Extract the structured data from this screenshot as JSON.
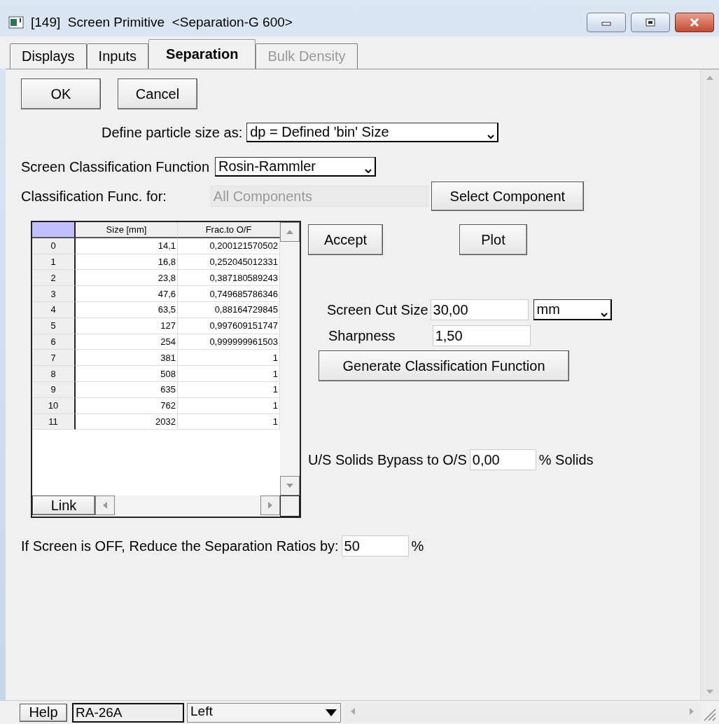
{
  "window": {
    "title": "[149]  Screen Primitive  <Separation-G 600>"
  },
  "tabs": [
    {
      "label": "Displays",
      "selected": false,
      "disabled": false
    },
    {
      "label": "Inputs",
      "selected": false,
      "disabled": false
    },
    {
      "label": "Separation",
      "selected": true,
      "disabled": false
    },
    {
      "label": "Bulk Density",
      "selected": false,
      "disabled": true
    }
  ],
  "buttons": [
    "OK",
    "Cancel"
  ],
  "particle_size": {
    "label": "Define particle size as:",
    "value": "dp = Defined 'bin' Size"
  },
  "classification_function": {
    "label": "Screen Classification Function",
    "value": "Rosin-Rammler"
  },
  "classification_for": {
    "label": "Classification Func. for:",
    "value": "All Components",
    "disabled": true,
    "button": "Select Component"
  },
  "table": {
    "columns": [
      "Size [mm]",
      "Frac.to O/F"
    ],
    "rows": [
      {
        "index": "0",
        "cells": [
          "14,1",
          "0,200121570502"
        ]
      },
      {
        "index": "1",
        "cells": [
          "16,8",
          "0,252045012331"
        ]
      },
      {
        "index": "2",
        "cells": [
          "23,8",
          "0,387180589243"
        ]
      },
      {
        "index": "3",
        "cells": [
          "47,6",
          "0,749685786346"
        ]
      },
      {
        "index": "4",
        "cells": [
          "63,5",
          "0,88164729845"
        ]
      },
      {
        "index": "5",
        "cells": [
          "127",
          "0,997609151747"
        ]
      },
      {
        "index": "6",
        "cells": [
          "254",
          "0,999999961503"
        ]
      },
      {
        "index": "7",
        "cells": [
          "381",
          "1"
        ]
      },
      {
        "index": "8",
        "cells": [
          "508",
          "1"
        ]
      },
      {
        "index": "9",
        "cells": [
          "635",
          "1"
        ]
      },
      {
        "index": "10",
        "cells": [
          "762",
          "1"
        ]
      },
      {
        "index": "11",
        "cells": [
          "2032",
          "1"
        ]
      }
    ],
    "link_button": "Link"
  },
  "accept_button": "Accept",
  "plot_button": "Plot",
  "cut_size": {
    "label": "Screen Cut Size",
    "value": "30,00",
    "unit": "mm"
  },
  "sharpness": {
    "label": "Sharpness",
    "value": "1,50"
  },
  "generate_button": "Generate Classification Function",
  "bypass": {
    "label": "U/S Solids Bypass to O/S",
    "value": "0,00",
    "unit": "% Solids"
  },
  "reduce": {
    "label": "If Screen is OFF, Reduce the Separation Ratios by:",
    "value": "50",
    "unit": "%"
  },
  "status_bar": {
    "help_button": "Help",
    "field": "RA-26A",
    "dropdown": "Left"
  }
}
